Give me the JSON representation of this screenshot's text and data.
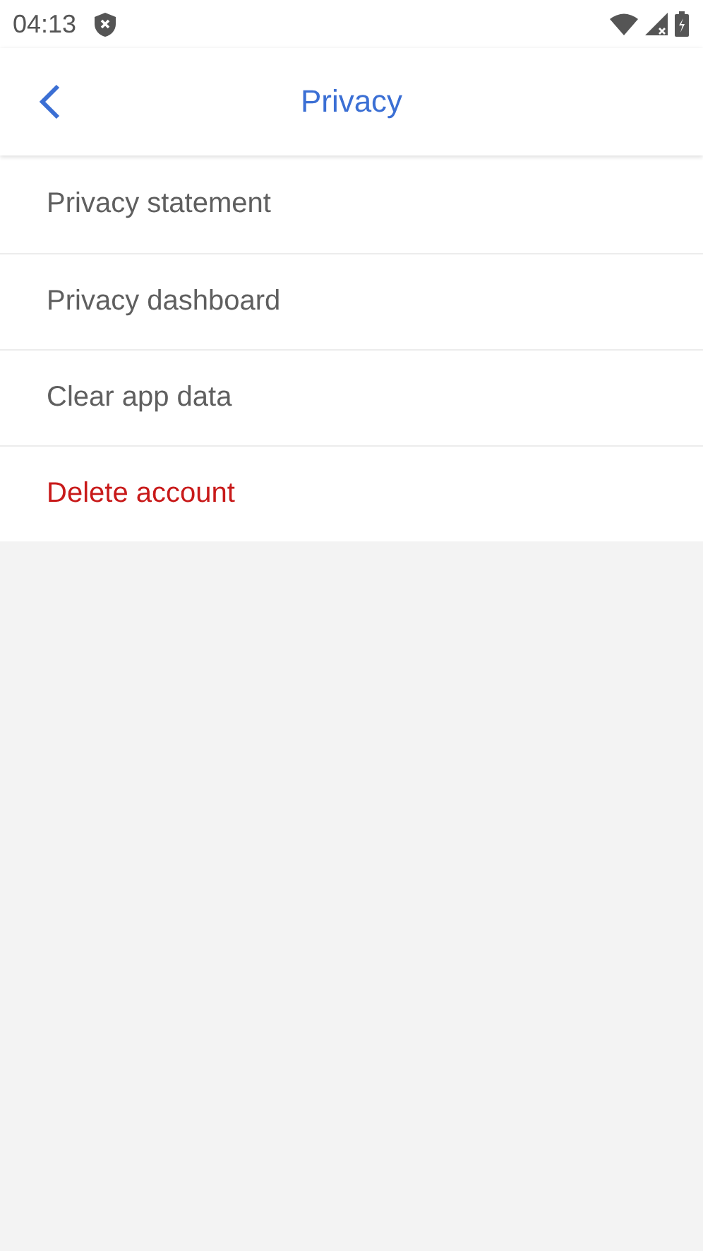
{
  "status_bar": {
    "time": "04:13"
  },
  "header": {
    "title": "Privacy"
  },
  "items": [
    {
      "label": "Privacy statement",
      "kind": "normal"
    },
    {
      "label": "Privacy dashboard",
      "kind": "normal"
    },
    {
      "label": "Clear app data",
      "kind": "normal"
    },
    {
      "label": "Delete account",
      "kind": "destructive"
    }
  ]
}
